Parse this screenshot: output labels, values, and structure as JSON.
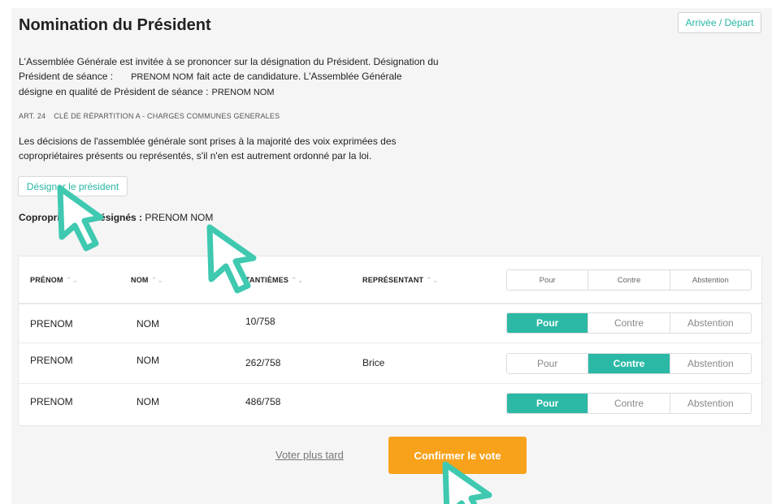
{
  "header": {
    "title": "Nomination du Président",
    "arrive_label": "Arrivée / Départ"
  },
  "description": {
    "line1": "L'Assemblée Générale est invitée à se prononcer sur la désignation du Président. Désignation du",
    "line2a": "Président de séance :",
    "line2_name": "PRENOM NOM",
    "line2b": "fait acte de candidature. L'Assemblée Générale",
    "line3a": "désigne en qualité de Président de séance :",
    "line3_name": "PRENOM NOM"
  },
  "article": {
    "art": "ART. 24",
    "key": "CLÉ DE RÉPARTITION A - CHARGES COMMUNES GENERALES"
  },
  "rule": {
    "line1": "Les décisions de l'assemblée générale sont prises à la majorité des voix exprimées des",
    "line2": "copropriétaires présents ou représentés, s'il n'en est autrement ordonné par la loi."
  },
  "designate_button": "Désigner le président",
  "designated": {
    "label": "Copropriétaires désignés :",
    "value": "PRENOM NOM"
  },
  "table": {
    "columns": {
      "prenom": "PRÉNOM",
      "nom": "NOM",
      "tantiemes": "TANTIÈMES",
      "representant": "REPRÉSENTANT"
    },
    "vote_options": [
      "Pour",
      "Contre",
      "Abstention"
    ],
    "rows": [
      {
        "prenom": "PRENOM",
        "nom": "NOM",
        "tantiemes": "10/758",
        "representant": "",
        "vote": "Pour"
      },
      {
        "prenom": "PRENOM",
        "nom": "NOM",
        "tantiemes": "262/758",
        "representant": "Brice",
        "vote": "Contre"
      },
      {
        "prenom": "PRENOM",
        "nom": "NOM",
        "tantiemes": "486/758",
        "representant": "",
        "vote": "Pour"
      }
    ]
  },
  "footer": {
    "later_label": "Voter plus tard",
    "confirm_label": "Confirmer le vote"
  },
  "colors": {
    "accent_teal": "#2bb9a5",
    "confirm_orange": "#f8a21b",
    "cursor_teal": "#3ec9b0"
  },
  "icons": {
    "sort": "sort-arrows-icon",
    "cursor": "pointer-cursor-icon"
  }
}
